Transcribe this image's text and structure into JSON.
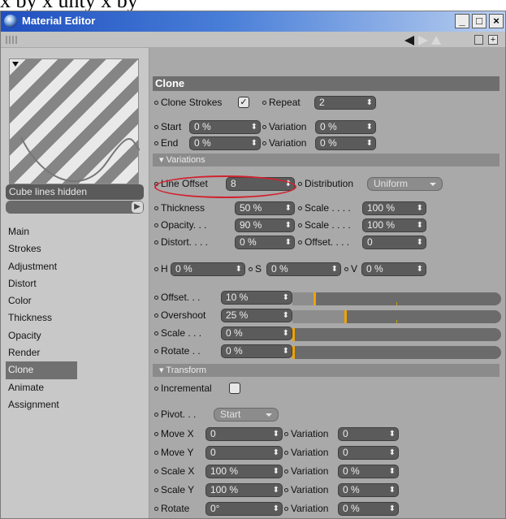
{
  "window": {
    "title": "Material Editor",
    "min_label": "_",
    "max_label": "□",
    "close_label": "×"
  },
  "material": {
    "name": "Cube lines hidden"
  },
  "nav": {
    "items": [
      "Main",
      "Strokes",
      "Adjustment",
      "Distort",
      "Color",
      "Thickness",
      "Opacity",
      "Render",
      "Clone",
      "Animate",
      "Assignment"
    ],
    "active": "Clone"
  },
  "clone": {
    "section_title": "Clone",
    "clone_strokes_label": "Clone Strokes",
    "clone_strokes_checked": true,
    "repeat_label": "Repeat",
    "repeat_value": "2",
    "start_label": "Start",
    "start_value": "0 %",
    "start_variation_label": "Variation",
    "start_variation_value": "0 %",
    "end_label": "End",
    "end_value": "0 %",
    "end_variation_label": "Variation",
    "end_variation_value": "0 %"
  },
  "variations": {
    "header": "Variations",
    "line_offset_label": "Line Offset",
    "line_offset_value": "8",
    "distribution_label": "Distribution",
    "distribution_value": "Uniform",
    "thickness_label": "Thickness",
    "thickness_value": "50 %",
    "thickness_scale_label": "Scale . . . .",
    "thickness_scale_value": "100 %",
    "opacity_label": "Opacity. . .",
    "opacity_value": "90 %",
    "opacity_scale_label": "Scale . . . .",
    "opacity_scale_value": "100 %",
    "distort_label": "Distort. . . .",
    "distort_value": "0 %",
    "distort_offset_label": "Offset. . . .",
    "distort_offset_value": "0",
    "h_label": "H",
    "h_value": "0 %",
    "s_label": "S",
    "s_value": "0 %",
    "v_label": "V",
    "v_value": "0 %",
    "offset_label": "Offset. . .",
    "offset_value": "10 %",
    "overshoot_label": "Overshoot",
    "overshoot_value": "25 %",
    "scale_label": "Scale . . .",
    "scale_value": "0 %",
    "rotate_label": "Rotate . .",
    "rotate_value": "0 %"
  },
  "transform": {
    "header": "Transform",
    "incremental_label": "Incremental",
    "pivot_label": "Pivot. . .",
    "pivot_value": "Start",
    "move_x_label": "Move X",
    "move_x_value": "0",
    "move_x_variation_label": "Variation",
    "move_x_variation_value": "0",
    "move_y_label": "Move Y",
    "move_y_value": "0",
    "move_y_variation_label": "Variation",
    "move_y_variation_value": "0",
    "scale_x_label": "Scale X",
    "scale_x_value": "100 %",
    "scale_x_variation_label": "Variation",
    "scale_x_variation_value": "0 %",
    "scale_y_label": "Scale Y",
    "scale_y_value": "100 %",
    "scale_y_variation_label": "Variation",
    "scale_y_variation_value": "0 %",
    "rotate_label": "Rotate",
    "rotate_value": "0°",
    "rotate_variation_label": "Variation",
    "rotate_variation_value": "0 %"
  },
  "icons": {
    "window_icon": "material-sphere-icon",
    "lock": "lock-icon",
    "new": "new-window-icon"
  },
  "colors": {
    "title_gradient_start": "#1f4fbf",
    "section_header": "#6e6e6e",
    "highlight_ring": "#d2212f",
    "slider_marker": "#f0a200"
  }
}
